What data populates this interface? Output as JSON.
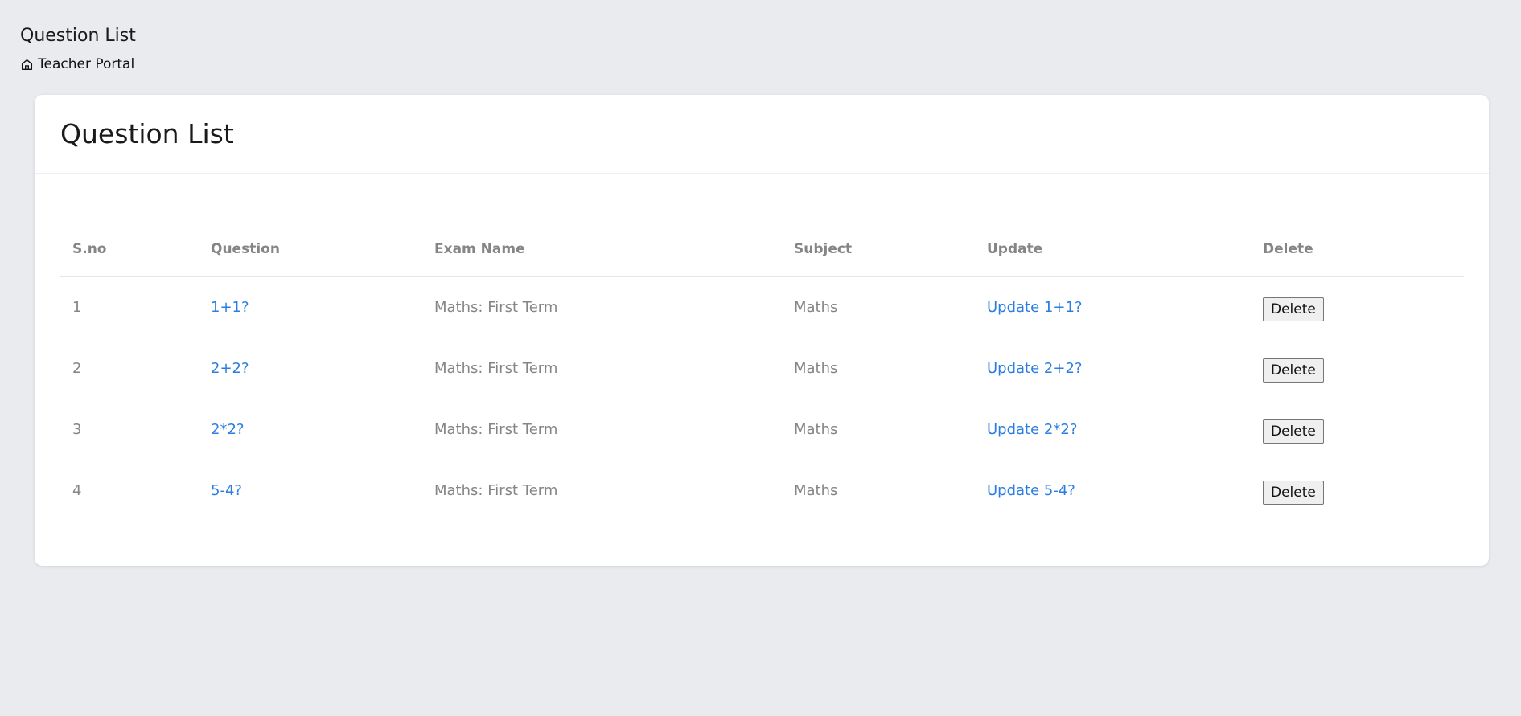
{
  "page": {
    "title": "Question List",
    "breadcrumb_label": "Teacher Portal"
  },
  "card": {
    "title": "Question List"
  },
  "table": {
    "headers": [
      "S.no",
      "Question",
      "Exam Name",
      "Subject",
      "Update",
      "Delete"
    ],
    "rows": [
      {
        "sno": "1",
        "question": "1+1?",
        "exam": "Maths: First Term",
        "subject": "Maths",
        "update": "Update 1+1?",
        "delete": "Delete"
      },
      {
        "sno": "2",
        "question": "2+2?",
        "exam": "Maths: First Term",
        "subject": "Maths",
        "update": "Update 2+2?",
        "delete": "Delete"
      },
      {
        "sno": "3",
        "question": "2*2?",
        "exam": "Maths: First Term",
        "subject": "Maths",
        "update": "Update 2*2?",
        "delete": "Delete"
      },
      {
        "sno": "4",
        "question": "5-4?",
        "exam": "Maths: First Term",
        "subject": "Maths",
        "update": "Update 5-4?",
        "delete": "Delete"
      }
    ]
  },
  "colors": {
    "background": "#e9ebef",
    "link": "#2b7de0",
    "muted_text": "#858585"
  },
  "icons": {
    "breadcrumb": "home-icon"
  }
}
